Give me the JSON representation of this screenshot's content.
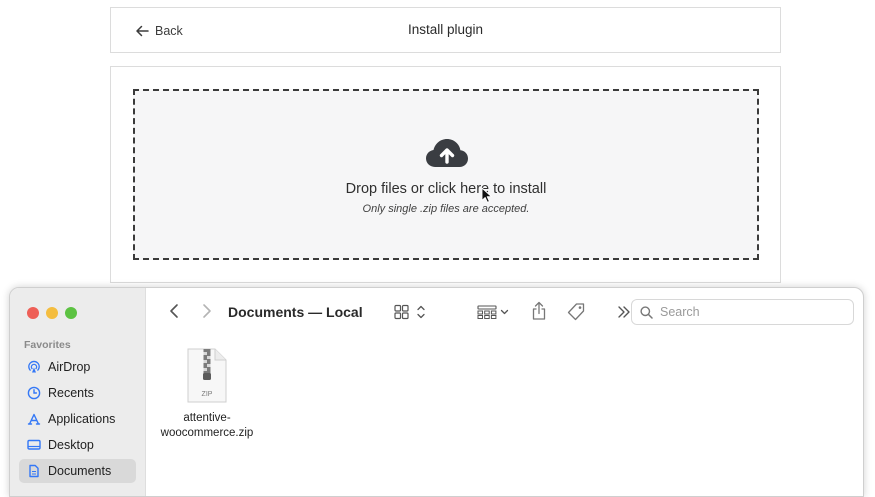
{
  "header": {
    "back_label": "Back",
    "title": "Install plugin"
  },
  "dropzone": {
    "title": "Drop files or click here to install",
    "subtitle": "Only single .zip files are accepted.",
    "icon": "cloud-upload-icon"
  },
  "finder": {
    "location_title": "Documents — Local",
    "search": {
      "placeholder": "Search",
      "value": ""
    },
    "sidebar": {
      "heading": "Favorites",
      "items": [
        {
          "label": "AirDrop",
          "icon": "airdrop-icon",
          "selected": false
        },
        {
          "label": "Recents",
          "icon": "clock-icon",
          "selected": false
        },
        {
          "label": "Applications",
          "icon": "applications-icon",
          "selected": false
        },
        {
          "label": "Desktop",
          "icon": "desktop-icon",
          "selected": false
        },
        {
          "label": "Documents",
          "icon": "document-icon",
          "selected": true
        }
      ]
    },
    "files": [
      {
        "name_line1": "attentive-",
        "name_line2": "woocommerce.zip",
        "badge": "ZIP"
      }
    ]
  },
  "colors": {
    "accent": "#3478f6",
    "traffic_red": "#ee5f57",
    "traffic_yellow": "#f4bd3f",
    "traffic_green": "#5cc242"
  }
}
